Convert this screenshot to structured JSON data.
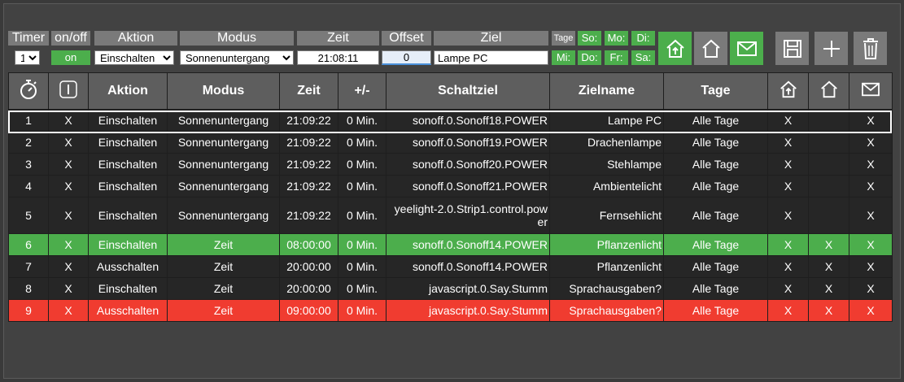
{
  "header": {
    "timer": "Timer",
    "onoff": "on/off",
    "aktion": "Aktion",
    "modus": "Modus",
    "zeit": "Zeit",
    "offset": "Offset",
    "ziel": "Ziel",
    "tage": "Tage"
  },
  "form": {
    "timer_value": "1",
    "on_label": "on",
    "aktion_value": "Einschalten",
    "modus_value": "Sonnenuntergang",
    "zeit_value": "21:08:11",
    "offset_value": "0",
    "ziel_value": "Lampe PC"
  },
  "days": [
    {
      "label": "So:"
    },
    {
      "label": "Mo:"
    },
    {
      "label": "Di:"
    },
    {
      "label": "Mi:"
    },
    {
      "label": "Do:"
    },
    {
      "label": "Fr:"
    },
    {
      "label": "Sa:"
    }
  ],
  "toolbar": {
    "home_arrive_icon": "home-arrive-icon",
    "home_icon": "home-icon",
    "mail_icon": "mail-icon",
    "save_icon": "save-icon",
    "add_icon": "plus-icon",
    "delete_icon": "trash-icon"
  },
  "table": {
    "columns": [
      "",
      "",
      "Aktion",
      "Modus",
      "Zeit",
      "+/-",
      "Schaltziel",
      "Zielname",
      "Tage",
      "",
      "",
      ""
    ],
    "rows": [
      {
        "nr": "1",
        "on": "X",
        "aktion": "Einschalten",
        "modus": "Sonnenuntergang",
        "zeit": "21:09:22",
        "offset": "0 Min.",
        "schaltziel": "sonoff.0.Sonoff18.POWER",
        "zielname": "Lampe PC",
        "tage": "Alle Tage",
        "c1": "X",
        "c2": "",
        "c3": "X"
      },
      {
        "nr": "2",
        "on": "X",
        "aktion": "Einschalten",
        "modus": "Sonnenuntergang",
        "zeit": "21:09:22",
        "offset": "0 Min.",
        "schaltziel": "sonoff.0.Sonoff19.POWER",
        "zielname": "Drachenlampe",
        "tage": "Alle Tage",
        "c1": "X",
        "c2": "",
        "c3": "X"
      },
      {
        "nr": "3",
        "on": "X",
        "aktion": "Einschalten",
        "modus": "Sonnenuntergang",
        "zeit": "21:09:22",
        "offset": "0 Min.",
        "schaltziel": "sonoff.0.Sonoff20.POWER",
        "zielname": "Stehlampe",
        "tage": "Alle Tage",
        "c1": "X",
        "c2": "",
        "c3": "X"
      },
      {
        "nr": "4",
        "on": "X",
        "aktion": "Einschalten",
        "modus": "Sonnenuntergang",
        "zeit": "21:09:22",
        "offset": "0 Min.",
        "schaltziel": "sonoff.0.Sonoff21.POWER",
        "zielname": "Ambientelicht",
        "tage": "Alle Tage",
        "c1": "X",
        "c2": "",
        "c3": "X"
      },
      {
        "nr": "5",
        "on": "X",
        "aktion": "Einschalten",
        "modus": "Sonnenuntergang",
        "zeit": "21:09:22",
        "offset": "0 Min.",
        "schaltziel": "yeelight-2.0.Strip1.control.power",
        "zielname": "Fernsehlicht",
        "tage": "Alle Tage",
        "c1": "X",
        "c2": "",
        "c3": "X"
      },
      {
        "nr": "6",
        "on": "X",
        "aktion": "Einschalten",
        "modus": "Zeit",
        "zeit": "08:00:00",
        "offset": "0 Min.",
        "schaltziel": "sonoff.0.Sonoff14.POWER",
        "zielname": "Pflanzenlicht",
        "tage": "Alle Tage",
        "c1": "X",
        "c2": "X",
        "c3": "X"
      },
      {
        "nr": "7",
        "on": "X",
        "aktion": "Ausschalten",
        "modus": "Zeit",
        "zeit": "20:00:00",
        "offset": "0 Min.",
        "schaltziel": "sonoff.0.Sonoff14.POWER",
        "zielname": "Pflanzenlicht",
        "tage": "Alle Tage",
        "c1": "X",
        "c2": "X",
        "c3": "X"
      },
      {
        "nr": "8",
        "on": "X",
        "aktion": "Einschalten",
        "modus": "Zeit",
        "zeit": "20:00:00",
        "offset": "0 Min.",
        "schaltziel": "javascript.0.Say.Stumm",
        "zielname": "Sprachausgaben?",
        "tage": "Alle Tage",
        "c1": "X",
        "c2": "X",
        "c3": "X"
      },
      {
        "nr": "9",
        "on": "X",
        "aktion": "Ausschalten",
        "modus": "Zeit",
        "zeit": "09:00:00",
        "offset": "0 Min.",
        "schaltziel": "javascript.0.Say.Stumm",
        "zielname": "Sprachausgaben?",
        "tage": "Alle Tage",
        "c1": "X",
        "c2": "X",
        "c3": "X"
      }
    ],
    "header_icons": [
      "stopwatch-icon",
      "power-switch-icon",
      "home-arrive-icon",
      "home-icon",
      "mail-icon"
    ]
  },
  "colors": {
    "accent_green": "#4cae4c",
    "accent_red": "#f03c30",
    "header_grey": "#7a7a7a",
    "row_dark": "#262626"
  }
}
